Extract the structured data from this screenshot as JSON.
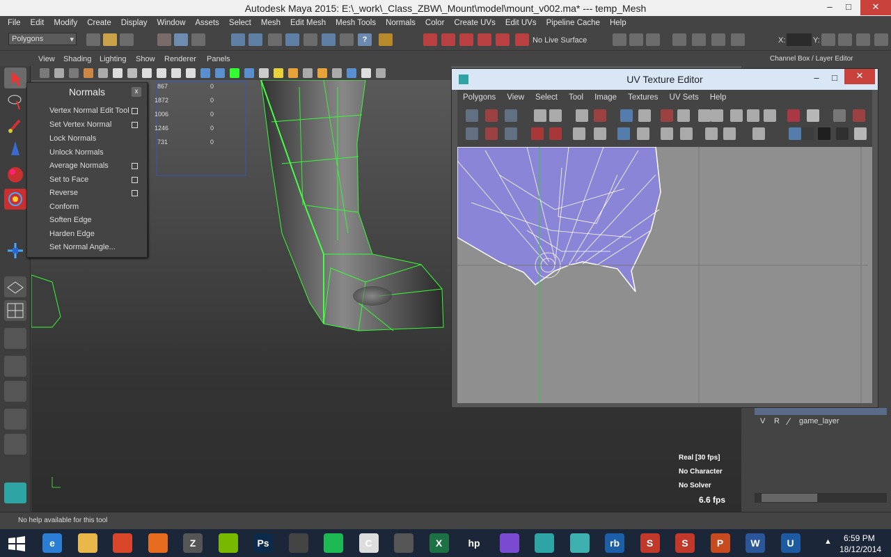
{
  "window": {
    "title": "Autodesk Maya 2015: E:\\_work\\_Class_ZBW\\_Mount\\model\\mount_v002.ma*   ---   temp_Mesh",
    "minimize_glyph": "–",
    "restore_glyph": "□",
    "close_glyph": "✕"
  },
  "menubar": {
    "items": [
      "File",
      "Edit",
      "Modify",
      "Create",
      "Display",
      "Window",
      "Assets",
      "Select",
      "Mesh",
      "Edit Mesh",
      "Mesh Tools",
      "Normals",
      "Color",
      "Create UVs",
      "Edit UVs",
      "Pipeline Cache",
      "Help"
    ]
  },
  "shelf": {
    "mode_select": "Polygons",
    "live_surface": "No Live Surface",
    "x_label": "X:",
    "y_label": "Y:"
  },
  "panel_menu": {
    "items": [
      "View",
      "Shading",
      "Lighting",
      "Show",
      "Renderer",
      "Panels"
    ],
    "channel_box_label": "Channel Box / Layer Editor"
  },
  "normals_panel": {
    "title": "Normals",
    "close": "x",
    "items": [
      {
        "label": "Vertex Normal Edit Tool",
        "has_option": true
      },
      {
        "label": "Set Vertex Normal",
        "has_option": true
      },
      {
        "label": "Lock Normals",
        "has_option": false
      },
      {
        "label": "Unlock Normals",
        "has_option": false
      },
      {
        "label": "Average Normals",
        "has_option": true
      },
      {
        "label": "Set to Face",
        "has_option": true
      },
      {
        "label": "Reverse",
        "has_option": true
      },
      {
        "label": "Conform",
        "has_option": false
      },
      {
        "label": "Soften Edge",
        "has_option": false
      },
      {
        "label": "Harden Edge",
        "has_option": false
      },
      {
        "label": "Set Normal Angle...",
        "has_option": false
      }
    ]
  },
  "poly_stats": {
    "rows": [
      {
        "left": "867",
        "right": "0"
      },
      {
        "left": "1872",
        "right": "0"
      },
      {
        "left": "1006",
        "right": "0"
      },
      {
        "left": "1246",
        "right": "0"
      },
      {
        "left": "731",
        "right": "0"
      }
    ]
  },
  "uv_editor": {
    "title": "UV Texture Editor",
    "menu": [
      "Polygons",
      "View",
      "Select",
      "Tool",
      "Image",
      "Textures",
      "UV Sets",
      "Help"
    ],
    "minimize_glyph": "–",
    "restore_glyph": "□",
    "close_glyph": "✕"
  },
  "hud": {
    "real_fps": "Real [30 fps]",
    "character": "No Character",
    "solver": "No Solver",
    "fps": "6.6 fps"
  },
  "layer_editor": {
    "v": "V",
    "r": "R",
    "layer_name": "game_layer"
  },
  "help_line": {
    "text": "No help available for this tool"
  },
  "taskbar": {
    "time": "6:59 PM",
    "date": "18/12/2014",
    "apps": [
      {
        "name": "internet-explorer",
        "glyph": "e",
        "color": "#2a7fd4"
      },
      {
        "name": "file-explorer",
        "glyph": "",
        "color": "#e8b84a"
      },
      {
        "name": "chrome",
        "glyph": "",
        "color": "#d9472b"
      },
      {
        "name": "firefox",
        "glyph": "",
        "color": "#e86c1f"
      },
      {
        "name": "zbrush",
        "glyph": "Z",
        "color": "#555555"
      },
      {
        "name": "nvidia",
        "glyph": "",
        "color": "#76b900"
      },
      {
        "name": "photoshop",
        "glyph": "Ps",
        "color": "#0c2a4a"
      },
      {
        "name": "indesign",
        "glyph": "",
        "color": "#444444"
      },
      {
        "name": "spotify",
        "glyph": "",
        "color": "#1db954"
      },
      {
        "name": "cinema",
        "glyph": "C",
        "color": "#dddddd"
      },
      {
        "name": "game",
        "glyph": "",
        "color": "#555555"
      },
      {
        "name": "excel",
        "glyph": "X",
        "color": "#1e7145"
      },
      {
        "name": "hp",
        "glyph": "hp",
        "color": "#1b2738"
      },
      {
        "name": "purple-app",
        "glyph": "",
        "color": "#7a4bd1"
      },
      {
        "name": "maya-1",
        "glyph": "",
        "color": "#2fa4a4"
      },
      {
        "name": "maya-2",
        "glyph": "",
        "color": "#3fb0b0"
      },
      {
        "name": "rb",
        "glyph": "rb",
        "color": "#1c5fa8"
      },
      {
        "name": "substance-1",
        "glyph": "S",
        "color": "#c0392b"
      },
      {
        "name": "substance-2",
        "glyph": "S",
        "color": "#c0392b"
      },
      {
        "name": "powerpoint",
        "glyph": "P",
        "color": "#c84b1f"
      },
      {
        "name": "word",
        "glyph": "W",
        "color": "#2b579a"
      },
      {
        "name": "unreal",
        "glyph": "U",
        "color": "#1e5aa0"
      }
    ]
  }
}
